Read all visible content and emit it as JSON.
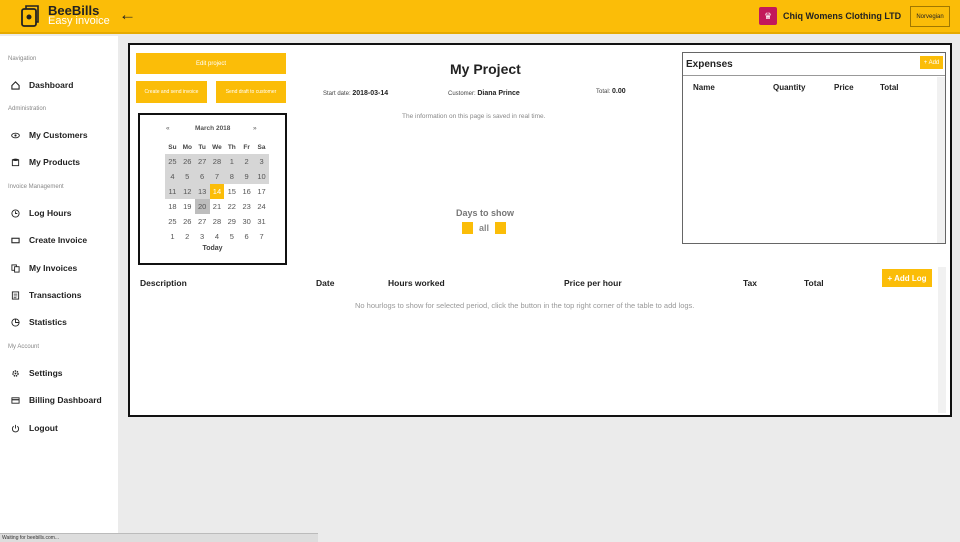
{
  "header": {
    "brand_title": "BeeBills",
    "brand_subtitle": "Easy invoice",
    "back_icon": "arrow-left-icon",
    "company_name": "Chiq Womens Clothing LTD",
    "language_button": "Norvegian"
  },
  "sidebar": {
    "sections": [
      {
        "label": "Navigation",
        "items": [
          {
            "label": "Dashboard",
            "icon": "home-icon"
          }
        ]
      },
      {
        "label": "Administration",
        "items": [
          {
            "label": "My Customers",
            "icon": "eye-icon"
          },
          {
            "label": "My Products",
            "icon": "database-icon"
          }
        ]
      },
      {
        "label": "Invoice Management",
        "items": [
          {
            "label": "Log Hours",
            "icon": "clock-icon"
          },
          {
            "label": "Create Invoice",
            "icon": "rectangle-icon"
          },
          {
            "label": "My Invoices",
            "icon": "documents-icon"
          },
          {
            "label": "Transactions",
            "icon": "list-icon"
          },
          {
            "label": "Statistics",
            "icon": "pie-icon"
          }
        ]
      },
      {
        "label": "My Account",
        "items": [
          {
            "label": "Settings",
            "icon": "gear-icon"
          },
          {
            "label": "Billing Dashboard",
            "icon": "card-icon"
          },
          {
            "label": "Logout",
            "icon": "power-icon"
          }
        ]
      }
    ]
  },
  "status_bar": {
    "text": "Waiting for beebills.com..."
  },
  "project": {
    "edit_button": "Edit project",
    "create_send_button": "Create and send invoice",
    "send_draft_button": "Send draft to customer",
    "title": "My Project",
    "start_date_label": "Start date:",
    "start_date": "2018-03-14",
    "customer_label": "Customer:",
    "customer": "Diana Prince",
    "total_label": "Total:",
    "total": "0.00",
    "info": "The information on this page is saved in real time.",
    "days_label": "Days to show",
    "days_value": "all"
  },
  "calendar": {
    "prev": "«",
    "next": "»",
    "month": "March 2018",
    "weekdays": [
      "Su",
      "Mo",
      "Tu",
      "We",
      "Th",
      "Fr",
      "Sa"
    ],
    "weeks": [
      [
        "25",
        "26",
        "27",
        "28",
        "1",
        "2",
        "3"
      ],
      [
        "4",
        "5",
        "6",
        "7",
        "8",
        "9",
        "10"
      ],
      [
        "11",
        "12",
        "13",
        "14",
        "15",
        "16",
        "17"
      ],
      [
        "18",
        "19",
        "20",
        "21",
        "22",
        "23",
        "24"
      ],
      [
        "25",
        "26",
        "27",
        "28",
        "29",
        "30",
        "31"
      ],
      [
        "1",
        "2",
        "3",
        "4",
        "5",
        "6",
        "7"
      ]
    ],
    "selected": "14",
    "today": "Today"
  },
  "expenses": {
    "title": "Expenses",
    "add_button": "+ Add",
    "columns": [
      "Name",
      "Quantity",
      "Price",
      "Total"
    ]
  },
  "logs": {
    "columns": [
      "Description",
      "Date",
      "Hours worked",
      "Price per hour",
      "Tax",
      "Total"
    ],
    "add_button": "+ Add Log",
    "empty_message": "No hourlogs to show for selected period, click the button in the top right corner of the table to add logs."
  },
  "colors": {
    "accent": "#fbbd08",
    "panel_border": "#111111"
  }
}
